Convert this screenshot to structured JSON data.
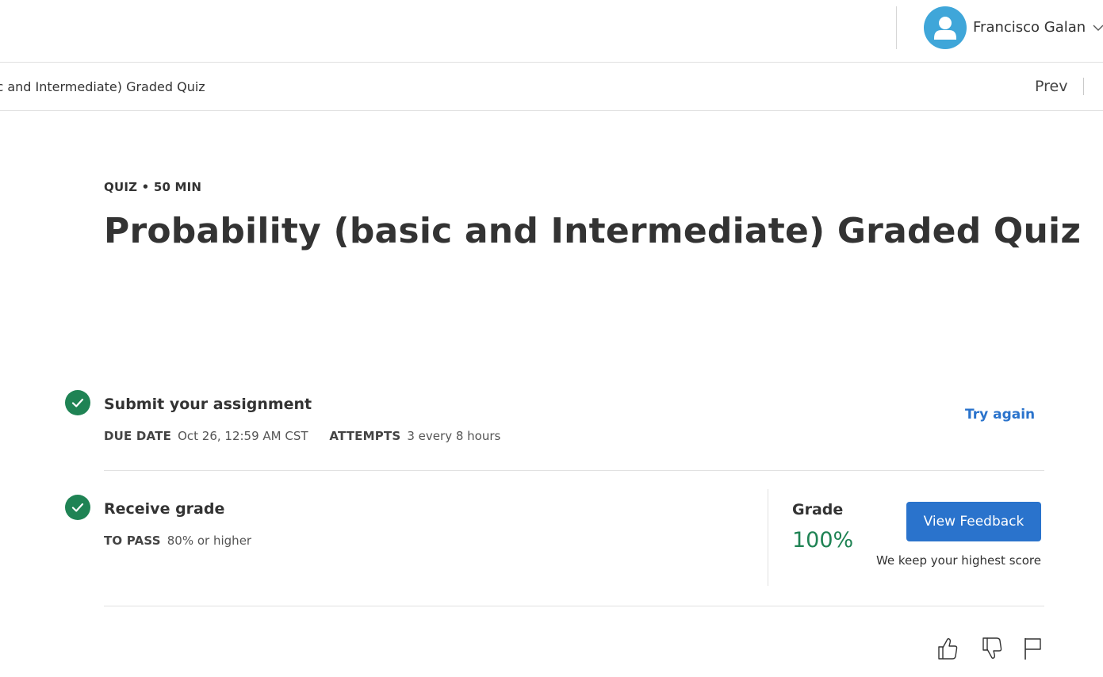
{
  "header": {
    "user_name": "Francisco Galan",
    "avatar_color": "#3fa6d9"
  },
  "subbar": {
    "breadcrumb": "ic and Intermediate) Graded Quiz",
    "prev_label": "Prev"
  },
  "main": {
    "eyebrow": "QUIZ • 50 MIN",
    "title": "Probability (basic and Intermediate) Graded Quiz"
  },
  "submit_step": {
    "title": "Submit your assignment",
    "due_key": "DUE DATE",
    "due_value": "Oct 26, 12:59 AM CST",
    "attempts_key": "ATTEMPTS",
    "attempts_value": "3 every 8 hours",
    "action_label": "Try again",
    "status": "complete"
  },
  "grade_step": {
    "title": "Receive grade",
    "pass_key": "TO PASS",
    "pass_value": "80% or higher",
    "grade_label": "Grade",
    "grade_value": "100%",
    "button_label": "View Feedback",
    "note": "We keep your highest score",
    "status": "complete"
  },
  "icons": {
    "like": "thumbs-up-icon",
    "dislike": "thumbs-down-icon",
    "flag": "flag-icon"
  },
  "colors": {
    "accent": "#2a73cc",
    "success": "#1f8354"
  }
}
